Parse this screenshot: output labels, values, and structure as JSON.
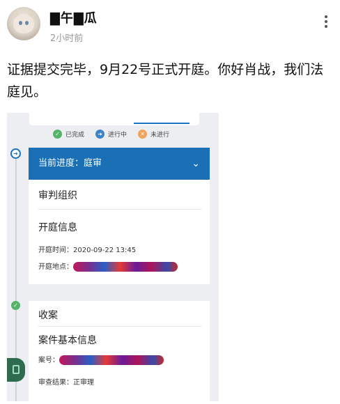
{
  "post": {
    "username": "▇午▇瓜",
    "time": "2小时前",
    "text": "证据提交完毕，9月22号正式开庭。你好肖战，我们法庭见。"
  },
  "screenshot": {
    "legend": {
      "done": "已完成",
      "in_progress": "进行中",
      "not_started": "未进行"
    },
    "stage": "当前进度：庭审",
    "sections": {
      "trial_org": "审判组织",
      "hearing_info": "开庭信息",
      "hearing_time_label": "开庭时间：",
      "hearing_time_value": "2020-09-22 13:45",
      "hearing_place_label": "开庭地点：",
      "filing": "收案",
      "case_basic": "案件基本信息",
      "case_no_label": "案号：",
      "review_result_label": "审查结果：",
      "review_result_value": "正审理"
    }
  },
  "colors": {
    "accent": "#1a6fb5",
    "done": "#56b36a",
    "todo": "#f0a35a"
  }
}
